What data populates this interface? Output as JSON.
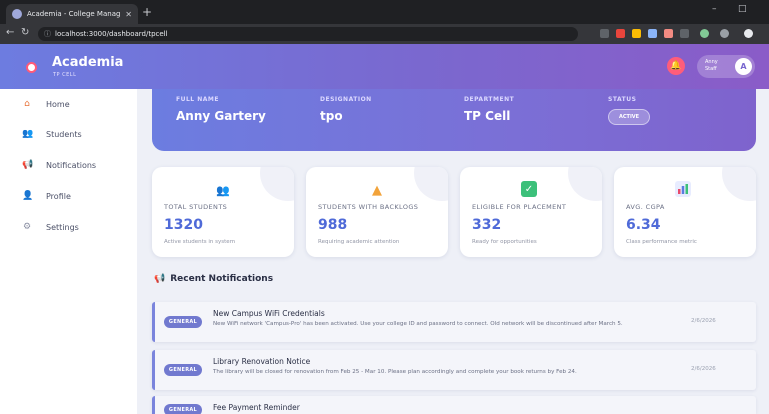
{
  "browser": {
    "tab_title": "Academia - College Management",
    "tab_close": "✕",
    "new_tab": "+",
    "url": "localhost:3000/dashboard/tpcell",
    "win_min": "–",
    "win_max": "□",
    "nav_back": "←",
    "nav_reload": "↻"
  },
  "header": {
    "brand": "Academia",
    "brand_sub": "TP CELL",
    "user_name": "Anny Staff",
    "user_initial": "A"
  },
  "sidebar": {
    "items": [
      {
        "label": "Home",
        "icon": "home-icon"
      },
      {
        "label": "Students",
        "icon": "students-icon"
      },
      {
        "label": "Notifications",
        "icon": "notifications-icon"
      },
      {
        "label": "Profile",
        "icon": "profile-icon"
      },
      {
        "label": "Settings",
        "icon": "settings-icon"
      }
    ]
  },
  "profile": {
    "full_name_label": "FULL NAME",
    "full_name": "Anny Gartery",
    "designation_label": "DESIGNATION",
    "designation": "tpo",
    "department_label": "DEPARTMENT",
    "department": "TP Cell",
    "status_label": "STATUS",
    "status": "ACTIVE"
  },
  "stats": [
    {
      "label": "TOTAL STUDENTS",
      "value": "1320",
      "desc": "Active students in system",
      "icon": "students-icon",
      "color": "#6a3db8"
    },
    {
      "label": "STUDENTS WITH BACKLOGS",
      "value": "988",
      "desc": "Requiring academic attention",
      "icon": "warning-icon",
      "color": "#f2a33a"
    },
    {
      "label": "ELIGIBLE FOR PLACEMENT",
      "value": "332",
      "desc": "Ready for opportunities",
      "icon": "check-icon",
      "color": "#3cc07a"
    },
    {
      "label": "AVG. CGPA",
      "value": "6.34",
      "desc": "Class performance metric",
      "icon": "chart-icon",
      "color": "#5b7be0"
    }
  ],
  "notifications_section": {
    "title": "Recent Notifications",
    "items": [
      {
        "badge": "GENERAL",
        "title": "New Campus WiFi Credentials",
        "body": "New WiFi network 'Campus-Pro' has been activated. Use your college ID and password to connect. Old network will be discontinued after March 5.",
        "date": "2/6/2026"
      },
      {
        "badge": "GENERAL",
        "title": "Library Renovation Notice",
        "body": "The library will be closed for renovation from Feb 25 - Mar 10. Please plan accordingly and complete your book returns by Feb 24.",
        "date": "2/6/2026"
      },
      {
        "badge": "GENERAL",
        "title": "Fee Payment Reminder",
        "body": "",
        "date": ""
      }
    ]
  }
}
